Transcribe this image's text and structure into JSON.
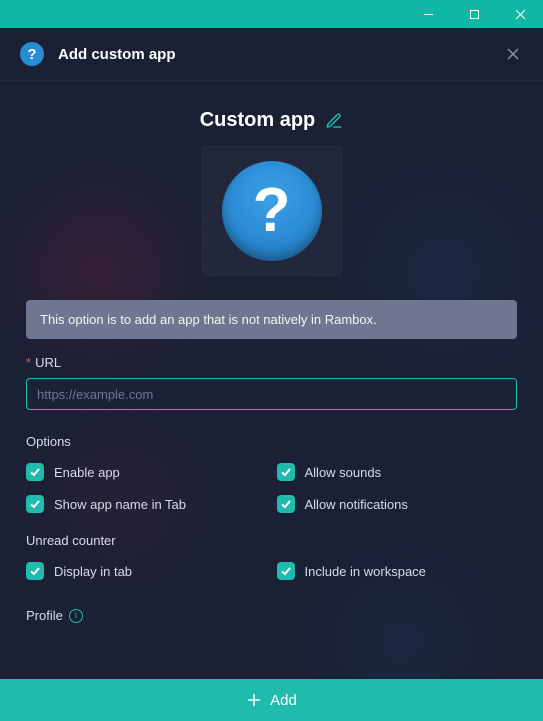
{
  "titlebar": {
    "minimize": "minimize",
    "maximize": "maximize",
    "close": "close"
  },
  "header": {
    "title": "Add custom app"
  },
  "main": {
    "app_name": "Custom app",
    "info_text": "This option is to add an app that is not natively in Rambox.",
    "url_label": "URL",
    "url_placeholder": "https://example.com",
    "url_value": "",
    "options_label": "Options",
    "options": {
      "enable_app": {
        "label": "Enable app",
        "checked": true
      },
      "allow_sounds": {
        "label": "Allow sounds",
        "checked": true
      },
      "show_app_name": {
        "label": "Show app name in Tab",
        "checked": true
      },
      "allow_notifications": {
        "label": "Allow notifications",
        "checked": true
      }
    },
    "unread_label": "Unread counter",
    "unread": {
      "display_in_tab": {
        "label": "Display in tab",
        "checked": true
      },
      "include_in_workspace": {
        "label": "Include in workspace",
        "checked": true
      }
    },
    "profile_label": "Profile"
  },
  "footer": {
    "add_label": "Add"
  },
  "colors": {
    "accent": "#1fbbac",
    "background": "#1b2135",
    "logo": "#278bd6"
  }
}
